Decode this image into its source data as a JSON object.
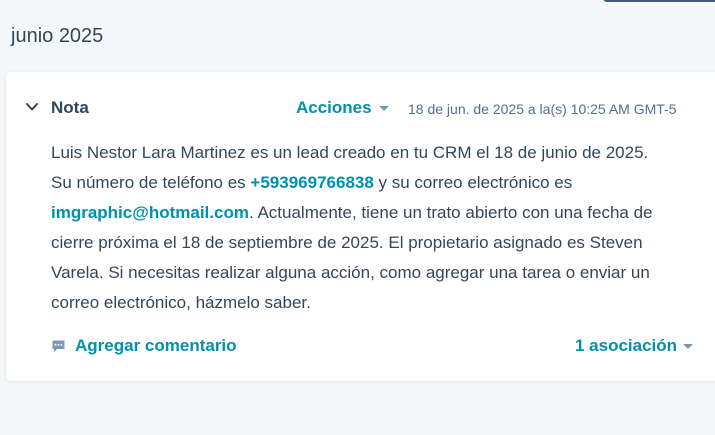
{
  "month_header": "junio 2025",
  "note": {
    "title": "Nota",
    "actions_label": "Acciones",
    "timestamp": "18 de jun. de 2025 a la(s) 10:25 AM GMT-5",
    "body": {
      "part1": "Luis Nestor Lara Martinez es un lead creado en tu CRM el 18 de junio de 2025. Su número de teléfono es ",
      "phone": "+593969766838",
      "part2": " y su correo electrónico es ",
      "email": "imgraphic@hotmail.com",
      "part3": ". Actualmente, tiene un trato abierto con una fecha de cierre próxima el 18 de septiembre de 2025. El propietario asignado es Steven Varela. Si necesitas realizar alguna acción, como agregar una tarea o enviar un correo electrónico, házmelo saber."
    },
    "add_comment_label": "Agregar comentario",
    "associations_label": "1 asociación"
  },
  "icons": {
    "collapse": "chevron-down-icon",
    "comment": "comment-icon",
    "dropdown": "caret-down-icon"
  },
  "colors": {
    "accent": "#0091ae",
    "text": "#33475b",
    "muted": "#516f90",
    "background": "#f5f8fa",
    "card": "#ffffff"
  }
}
